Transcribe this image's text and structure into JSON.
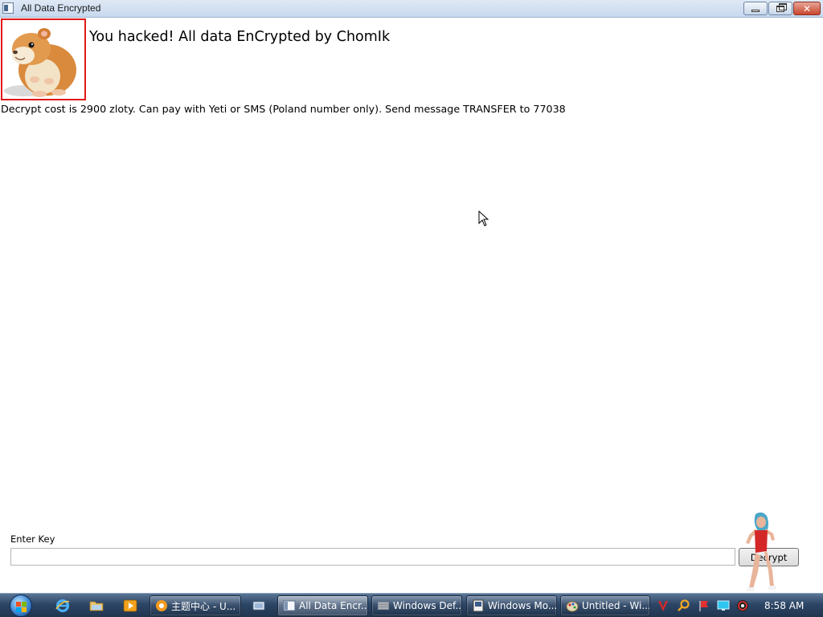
{
  "window": {
    "title": "All Data Encrypted",
    "icon": "app-window-icon",
    "controls": {
      "minimize": "minimize-icon",
      "maximize": "restore-icon",
      "close": "close-icon"
    }
  },
  "content": {
    "image": "hamster-image",
    "headline": "You hacked! All data EnCrypted by ChomIk",
    "message": "Decrypt cost is 2900 zloty. Can pay with Yeti or SMS (Poland number only). Send message TRANSFER to 77038",
    "key_label": "Enter Key",
    "key_value": "",
    "key_placeholder": "",
    "decrypt_label": "Decrypt",
    "overlay": "dancing-woman-image",
    "accent_color": "#e01818"
  },
  "taskbar": {
    "start_icon": "windows-start-orb",
    "quick_launch": [
      "internet-explorer-icon",
      "folder-icon",
      "media-player-icon",
      "show-desktop-icon"
    ],
    "tasks": [
      {
        "label": "主题中心 - U...",
        "icon": "theme-center-icon"
      },
      {
        "label": "All Data Encr...",
        "icon": "window-icon",
        "active": true
      },
      {
        "label": "Windows Def...",
        "icon": "defender-icon"
      },
      {
        "label": "Windows Mo...",
        "icon": "movie-maker-icon"
      },
      {
        "label": "Untitled - Wi...",
        "icon": "paint-icon"
      }
    ],
    "tray": [
      "v-antivirus-icon",
      "search-icon",
      "flag-icon",
      "monitor-icon",
      "volume-icon"
    ],
    "clock": "8:58 AM"
  }
}
